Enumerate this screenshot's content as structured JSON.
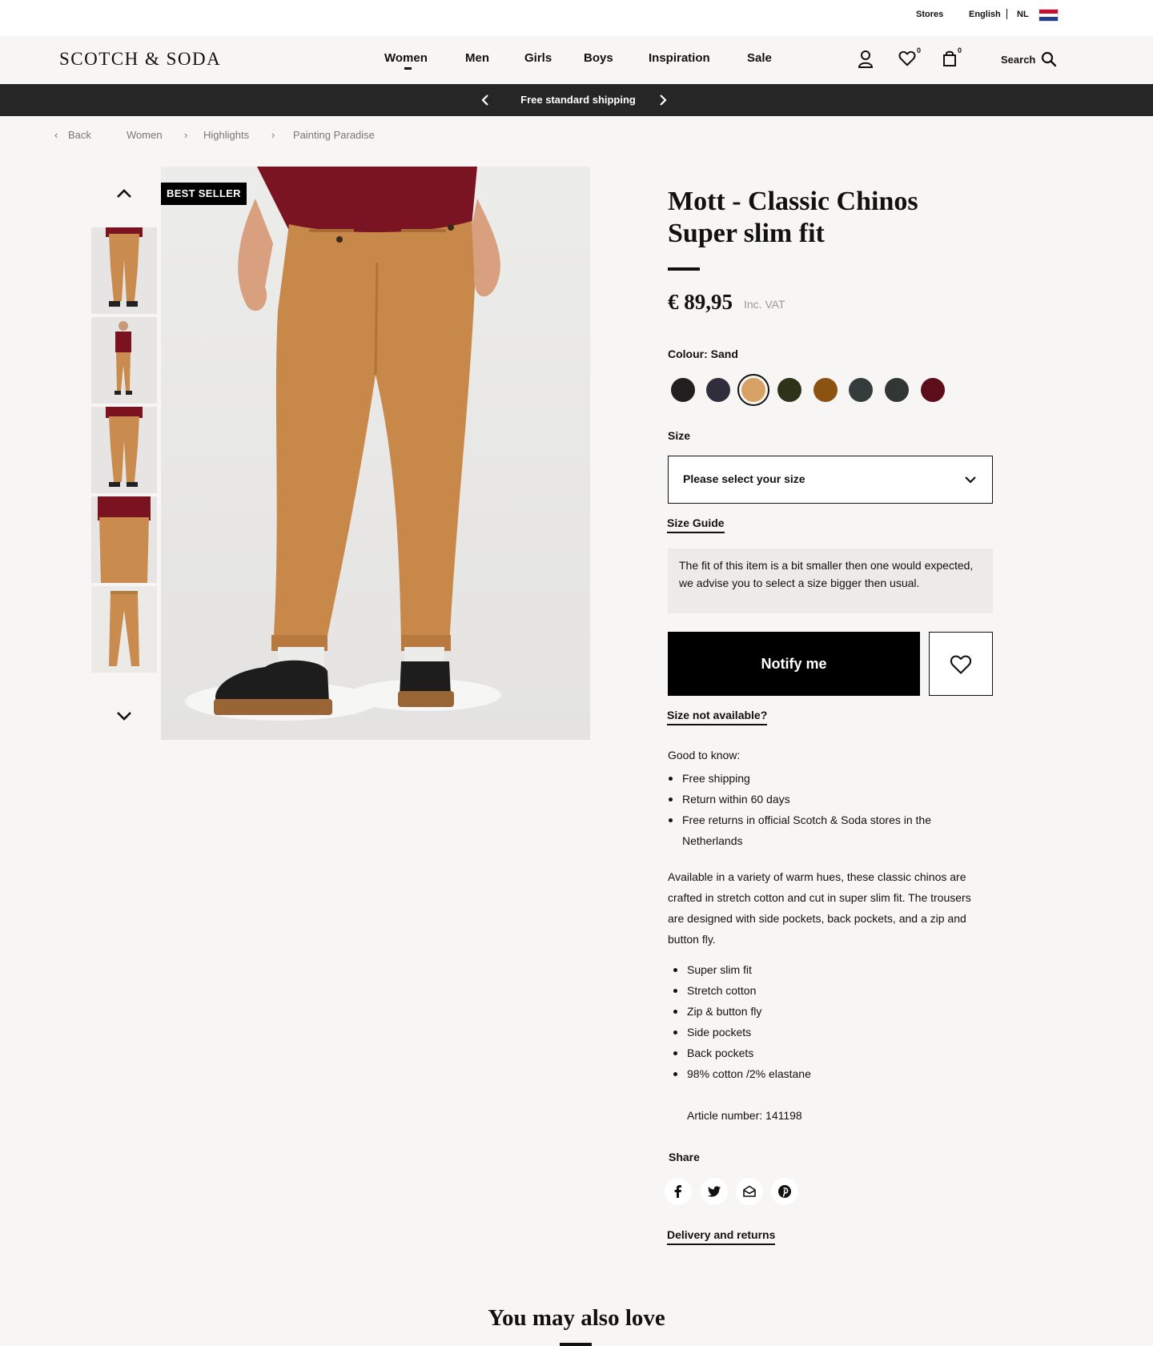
{
  "utility": {
    "stores": "Stores",
    "language": "English",
    "country": "NL"
  },
  "brand": {
    "logo": "SCOTCH & SODA"
  },
  "nav": {
    "items": [
      "Women",
      "Men",
      "Girls",
      "Boys",
      "Inspiration",
      "Sale"
    ],
    "active": "Women",
    "wishlist_count": "0",
    "cart_count": "0",
    "search_label": "Search"
  },
  "promo": {
    "text": "Free standard shipping"
  },
  "breadcrumb": {
    "back": "Back",
    "items": [
      "Women",
      "Highlights",
      "Painting Paradise"
    ]
  },
  "gallery": {
    "badge": "BEST SELLER",
    "thumbnail_count": 5
  },
  "product": {
    "title_line1": "Mott - Classic Chinos",
    "title_line2": "Super slim fit",
    "price": "€ 89,95",
    "vat_note": "Inc. VAT",
    "colour_label": "Colour: Sand",
    "colours": [
      {
        "name": "black",
        "hex": "#231f20"
      },
      {
        "name": "navy",
        "hex": "#302d3c"
      },
      {
        "name": "sand",
        "hex": "#d7a065",
        "selected": true
      },
      {
        "name": "olive",
        "hex": "#2d3219"
      },
      {
        "name": "caramel",
        "hex": "#8b5211"
      },
      {
        "name": "charcoal",
        "hex": "#363b3c"
      },
      {
        "name": "dark-grey",
        "hex": "#323736"
      },
      {
        "name": "burgundy",
        "hex": "#5d0d1a"
      }
    ],
    "size_label": "Size",
    "size_placeholder": "Please select your size",
    "size_guide": "Size Guide",
    "fit_note": "The fit of this item is a bit smaller then one would expected, we advise you to select a size bigger then usual.",
    "notify_label": "Notify me",
    "size_not_available": "Size not available?",
    "good_to_know_title": "Good to know:",
    "good_to_know": [
      "Free shipping",
      "Return within 60 days",
      "Free returns in official Scotch & Soda stores in the Netherlands"
    ],
    "description": "Available in a variety of warm hues, these classic chinos are crafted in stretch cotton and cut in super slim fit. The trousers are designed with side pockets, back pockets, and a zip and button fly.",
    "features": [
      "Super slim fit",
      "Stretch cotton",
      "Zip & button fly",
      "Side pockets",
      "Back pockets",
      "98% cotton /2% elastane"
    ],
    "article_number": "Article number: 141198",
    "share_label": "Share",
    "share_icons": [
      "facebook-icon",
      "twitter-icon",
      "email-icon",
      "pinterest-icon"
    ],
    "delivery_returns": "Delivery and returns"
  },
  "recommendations": {
    "title": "You may also love"
  }
}
